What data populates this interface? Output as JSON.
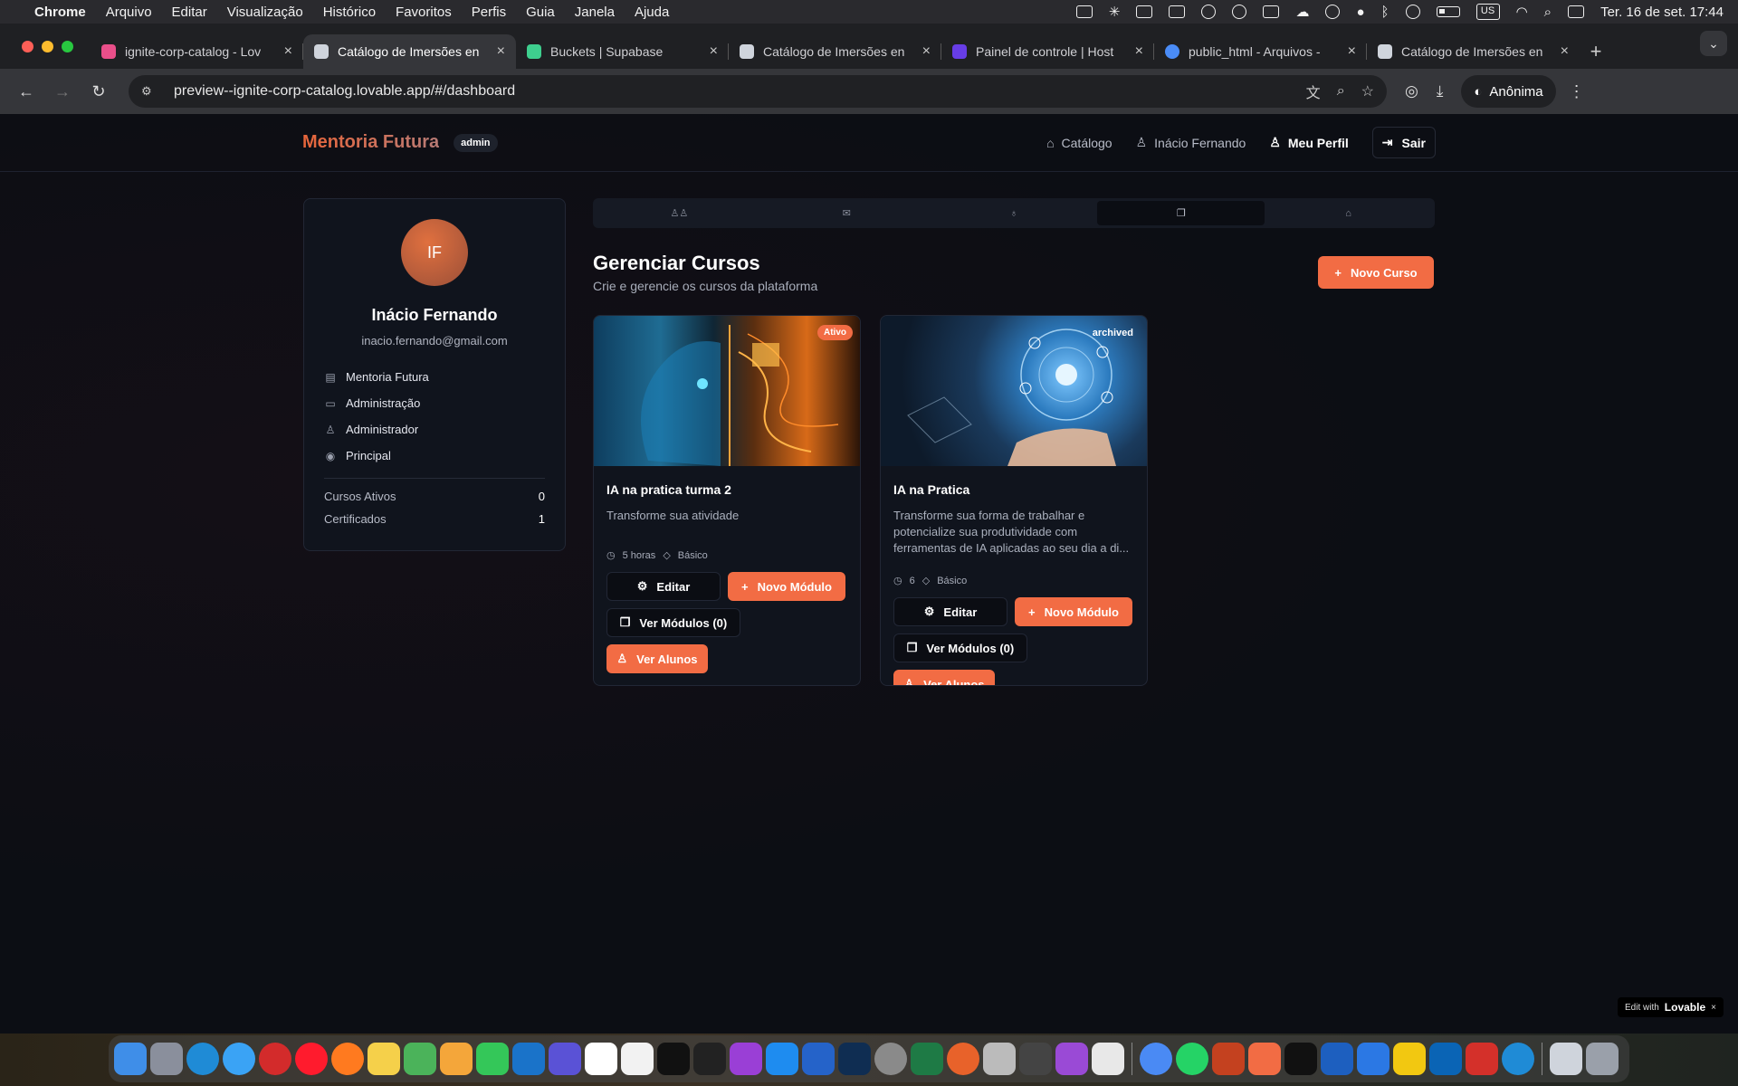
{
  "menubar": {
    "items": [
      "Chrome",
      "Arquivo",
      "Editar",
      "Visualização",
      "Histórico",
      "Favoritos",
      "Perfis",
      "Guia",
      "Janela",
      "Ajuda"
    ],
    "keyboard": "US",
    "datetime": "Ter. 16 de set.  17:44"
  },
  "tabs": [
    {
      "title": "ignite-corp-catalog - Lov",
      "color": "#e94f8a"
    },
    {
      "title": "Catálogo de Imersões en",
      "color": "#cfd4dc"
    },
    {
      "title": "Buckets | Supabase",
      "color": "#3ecf8e"
    },
    {
      "title": "Catálogo de Imersões en",
      "color": "#cfd4dc"
    },
    {
      "title": "Painel de controle | Host",
      "color": "#673de6"
    },
    {
      "title": "public_html - Arquivos -",
      "color": "#4a8cf7"
    },
    {
      "title": "Catálogo de Imersões en",
      "color": "#cfd4dc"
    }
  ],
  "toolbar": {
    "url": "preview--ignite-corp-catalog.lovable.app/#/dashboard",
    "incognito_label": "Anônima"
  },
  "app": {
    "brand": "Mentoria Futura",
    "role_badge": "admin",
    "nav": {
      "catalog": "Catálogo",
      "user": "Inácio Fernando",
      "profile": "Meu Perfil",
      "logout": "Sair"
    }
  },
  "profile": {
    "initials": "IF",
    "name": "Inácio Fernando",
    "email": "inacio.fernando@gmail.com",
    "company": "Mentoria Futura",
    "department": "Administração",
    "role": "Administrador",
    "location": "Principal",
    "stats": {
      "active_label": "Cursos Ativos",
      "active_value": "0",
      "certs_label": "Certificados",
      "certs_value": "1"
    }
  },
  "section": {
    "title": "Gerenciar Cursos",
    "subtitle": "Crie e gerencie os cursos da plataforma",
    "new_course": "Novo Curso"
  },
  "courses": [
    {
      "status": "Ativo",
      "title": "IA na pratica turma 2",
      "description": "Transforme sua atividade",
      "duration": "5 horas",
      "level": "Básico",
      "edit": "Editar",
      "new_module": "Novo Módulo",
      "view_modules": "Ver Módulos (0)",
      "view_students": "Ver Alunos"
    },
    {
      "status": "archived",
      "title": "IA na Pratica",
      "description": "Transforme sua forma de trabalhar e potencialize sua produtividade com ferramentas de IA aplicadas ao seu dia a di...",
      "duration": "6",
      "level": "Básico",
      "edit": "Editar",
      "new_module": "Novo Módulo",
      "view_modules": "Ver Módulos (0)",
      "view_students": "Ver Alunos"
    }
  ],
  "lovable": {
    "prefix": "Edit with",
    "brand": "Lovable"
  },
  "colors": {
    "accent": "#f26c44",
    "bg": "#0c0e14",
    "card": "#10141d"
  }
}
